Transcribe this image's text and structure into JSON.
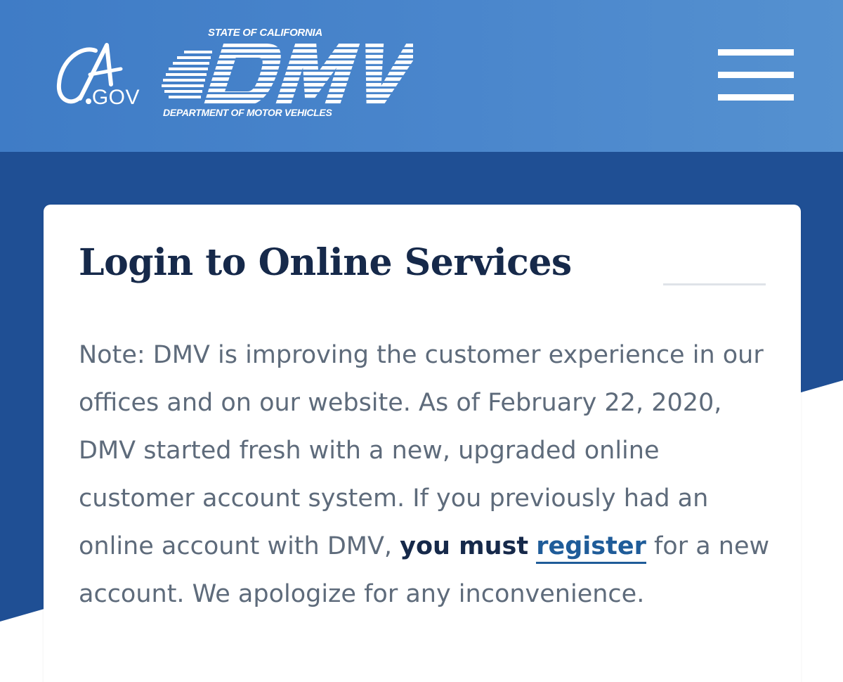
{
  "header": {
    "ca_logo_text": "CA",
    "ca_gov_text": ".GOV",
    "dmv_state_text": "STATE OF CALIFORNIA",
    "dmv_letters": "DMV",
    "dmv_department_text": "DEPARTMENT OF MOTOR VEHICLES",
    "menu_icon": "hamburger-menu-icon"
  },
  "card": {
    "title": "Login to Online Services",
    "note_part1": "Note: DMV is improving the customer experience in our offices and on our website. As of February 22, 2020, DMV started fresh with a new, upgraded online customer account system. If you previously had an online account with DMV, ",
    "note_strong": "you must",
    "note_space": " ",
    "note_link": "register",
    "note_part2": " for a new account. We apologize for any inconvenience."
  },
  "colors": {
    "header_blue": "#4a86cc",
    "band_blue": "#1f4f94",
    "title_navy": "#16294a",
    "link_blue": "#1f5c99",
    "body_gray": "#5e6b7b"
  }
}
